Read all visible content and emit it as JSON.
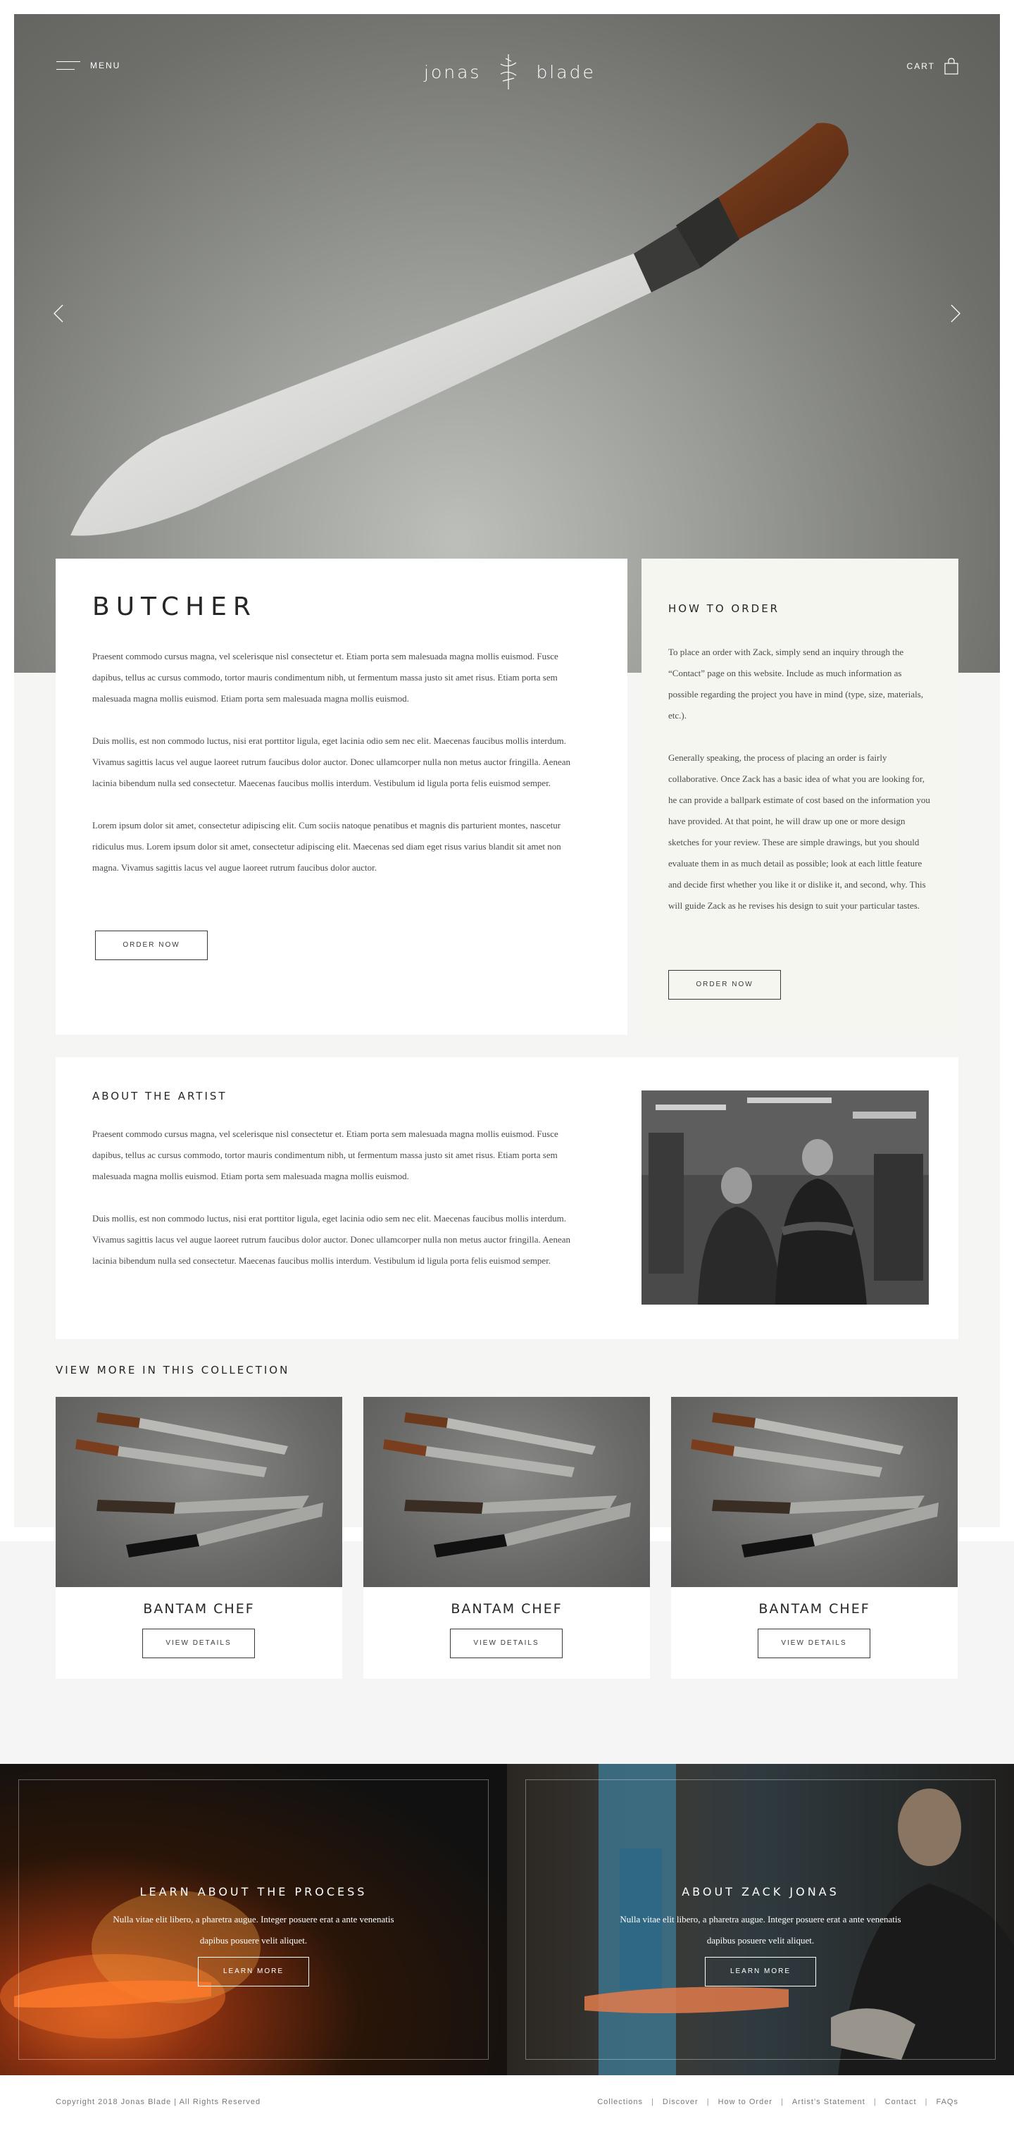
{
  "nav": {
    "menu_label": "MENU",
    "logo_left": "jonas",
    "logo_right": "blade",
    "cart_label": "CART"
  },
  "product": {
    "title": "BUTCHER",
    "paragraphs": [
      "Praesent commodo cursus magna, vel scelerisque nisl consectetur et. Etiam porta sem malesuada magna mollis euismod. Fusce dapibus, tellus ac cursus commodo, tortor mauris condimentum nibh, ut fermentum massa justo sit amet risus. Etiam porta sem malesuada magna mollis euismod. Etiam porta sem malesuada magna mollis euismod.",
      "Duis mollis, est non commodo luctus, nisi erat porttitor ligula, eget lacinia odio sem nec elit. Maecenas faucibus mollis interdum. Vivamus sagittis lacus vel augue laoreet rutrum faucibus dolor auctor. Donec ullamcorper nulla non metus auctor fringilla. Aenean lacinia bibendum nulla sed consectetur. Maecenas faucibus mollis interdum. Vestibulum id ligula porta felis euismod semper.",
      "Lorem ipsum dolor sit amet, consectetur adipiscing elit. Cum sociis natoque penatibus et magnis dis parturient montes, nascetur ridiculus mus. Lorem ipsum dolor sit amet, consectetur adipiscing elit. Maecenas sed diam eget risus varius blandit sit amet non magna. Vivamus sagittis lacus vel augue laoreet rutrum faucibus dolor auctor."
    ],
    "order_label": "ORDER NOW"
  },
  "how_to_order": {
    "title": "HOW TO ORDER",
    "paragraphs": [
      "To place an order with Zack, simply send an inquiry through the “Contact” page on this website. Include as much information as possible regarding the project you have in mind (type, size, materials, etc.).",
      "Generally speaking, the process of placing an order is fairly collaborative. Once Zack has a basic idea of what you are looking for, he can provide a ballpark estimate of cost based on the information you have provided. At that point, he will draw up one or more design sketches for your review. These are simple drawings, but you should evaluate them in as much detail as possible; look at each little feature and decide first whether you like it or dislike it, and second, why. This will guide Zack as he revises his design to suit your particular tastes."
    ],
    "order_label": "ORDER NOW"
  },
  "artist": {
    "title": "ABOUT THE ARTIST",
    "paragraphs": [
      "Praesent commodo cursus magna, vel scelerisque nisl consectetur et. Etiam porta sem malesuada magna mollis euismod. Fusce dapibus, tellus ac cursus commodo, tortor mauris condimentum nibh, ut fermentum massa justo sit amet risus. Etiam porta sem malesuada magna mollis euismod. Etiam porta sem malesuada magna mollis euismod.",
      "Duis mollis, est non commodo luctus, nisi erat porttitor ligula, eget lacinia odio sem nec elit. Maecenas faucibus mollis interdum. Vivamus sagittis lacus vel augue laoreet rutrum faucibus dolor auctor. Donec ullamcorper nulla non metus auctor fringilla. Aenean lacinia bibendum nulla sed consectetur. Maecenas faucibus mollis interdum. Vestibulum id ligula porta felis euismod semper."
    ]
  },
  "collection": {
    "title": "VIEW MORE IN THIS COLLECTION",
    "items": [
      {
        "name": "BANTAM CHEF",
        "button": "VIEW DETAILS"
      },
      {
        "name": "BANTAM CHEF",
        "button": "VIEW DETAILS"
      },
      {
        "name": "BANTAM CHEF",
        "button": "VIEW DETAILS"
      }
    ]
  },
  "promos": [
    {
      "title": "LEARN ABOUT THE PROCESS",
      "text": "Nulla vitae elit libero, a pharetra augue. Integer posuere erat a ante venenatis dapibus posuere velit aliquet.",
      "button": "LEARN MORE"
    },
    {
      "title": "ABOUT ZACK JONAS",
      "text": "Nulla vitae elit libero, a pharetra augue. Integer posuere erat a ante venenatis dapibus posuere velit aliquet.",
      "button": "LEARN MORE"
    }
  ],
  "footer": {
    "copyright": "Copyright 2018 Jonas Blade | All Rights Reserved",
    "links": [
      "Collections",
      "Discover",
      "How to Order",
      "Artist’s Statement",
      "Contact",
      "FAQs"
    ]
  },
  "icons": {
    "menu": "hamburger-icon",
    "logo_mark": "blade-logo-icon",
    "cart": "shopping-bag-icon",
    "prev": "chevron-left-icon",
    "next": "chevron-right-icon"
  },
  "colors": {
    "accent_dark": "#262626",
    "card_tint": "#f6f6f1",
    "page_bg": "#f5f5f3"
  }
}
